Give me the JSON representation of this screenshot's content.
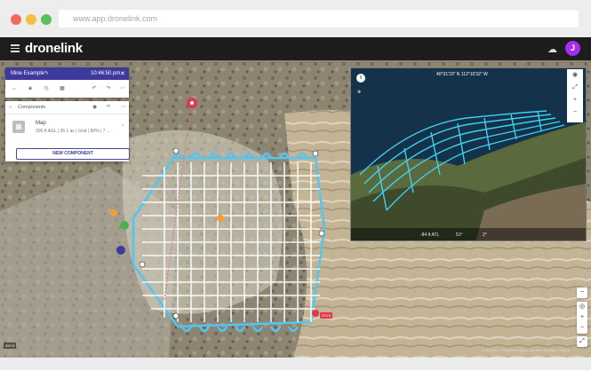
{
  "browser": {
    "url": "www.app.dronelink.com"
  },
  "app": {
    "logo": "dronelink",
    "avatar_initial": "J"
  },
  "mission": {
    "title": "Mine Example",
    "time": "10:46:50 pm",
    "close": "✕"
  },
  "components": {
    "header": "Components",
    "items": [
      {
        "name": "Map",
        "meta": "200 ft AGL | 35.1 ac | Grid | 80% | 7 ..."
      }
    ],
    "new_button": "NEW COMPONENT"
  },
  "view3d": {
    "coordinates": "40°31'23\" N 112°10'32\" W",
    "stats": {
      "altitude": "-84 ft ATL",
      "heading": "51°",
      "tilt": "2°"
    }
  },
  "map": {
    "scale_label": "200 ft",
    "attribution": "© Mapbox © OpenStreetMap Improve this Map © Maxar",
    "marker_label": "374 ft"
  },
  "colors": {
    "header_bg": "#1d1d1d",
    "mission_header": "#3d3a9c",
    "avatar": "#a62cf0",
    "flight_path": "#52c6f0",
    "grid": "#ffffff",
    "marker_red": "#e0394f"
  }
}
